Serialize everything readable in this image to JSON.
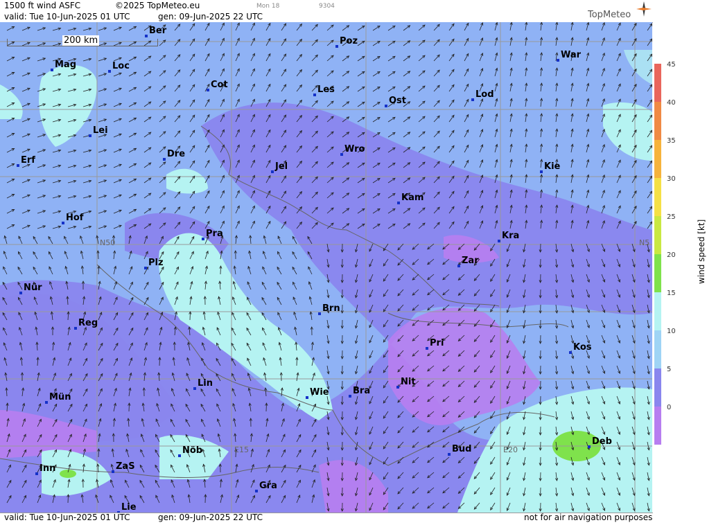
{
  "header": {
    "product": "1500 ft wind ASFC",
    "copyright": "©2025 TopMeteo.eu",
    "model_tag": "Mon 18",
    "code_tag": "9304",
    "valid": "valid:  Tue  10-Jun-2025  01 UTC",
    "generated": "gen: 09-Jun-2025 22 UTC",
    "logo": "TopMeteo"
  },
  "footer": {
    "valid": "valid:  Tue  10-Jun-2025  01 UTC",
    "generated": "gen: 09-Jun-2025 22 UTC",
    "disclaimer": "not for air navigation purposes"
  },
  "scale_bar": {
    "label": "200 km"
  },
  "grid_labels": {
    "lat50": "N50",
    "lat50_right": "N5",
    "lon15": "E15",
    "lon20": "E20"
  },
  "legend": {
    "title": "wind  speed  [kt]",
    "ticks": [
      "45",
      "40",
      "35",
      "30",
      "25",
      "20",
      "15",
      "10",
      "5",
      "0"
    ],
    "colors": [
      "#e9665c",
      "#f08a44",
      "#f6b33c",
      "#f5e046",
      "#c9e842",
      "#7fe24c",
      "#b5f3f2",
      "#9fd4f5",
      "#8a86ee",
      "#b77ef0"
    ]
  },
  "cities": [
    {
      "name": "Ber"
    },
    {
      "name": "Poz"
    },
    {
      "name": "War"
    },
    {
      "name": "Mag"
    },
    {
      "name": "Loc"
    },
    {
      "name": "Cot"
    },
    {
      "name": "Les"
    },
    {
      "name": "Ost"
    },
    {
      "name": "Lod"
    },
    {
      "name": "Lei"
    },
    {
      "name": "Dre"
    },
    {
      "name": "Wro"
    },
    {
      "name": "Erf"
    },
    {
      "name": "Jel"
    },
    {
      "name": "Kie"
    },
    {
      "name": "Kam"
    },
    {
      "name": "Hof"
    },
    {
      "name": "Pra"
    },
    {
      "name": "Kra"
    },
    {
      "name": "Plz"
    },
    {
      "name": "Zar"
    },
    {
      "name": "Nür"
    },
    {
      "name": "Brn"
    },
    {
      "name": "Reg"
    },
    {
      "name": "Pri"
    },
    {
      "name": "Kos"
    },
    {
      "name": "Lin"
    },
    {
      "name": "Nit"
    },
    {
      "name": "Mün"
    },
    {
      "name": "Wie"
    },
    {
      "name": "Bra"
    },
    {
      "name": "Deb"
    },
    {
      "name": "Nöb"
    },
    {
      "name": "Bud"
    },
    {
      "name": "Inn"
    },
    {
      "name": "ZaS"
    },
    {
      "name": "Gra"
    },
    {
      "name": "Lie"
    }
  ]
}
